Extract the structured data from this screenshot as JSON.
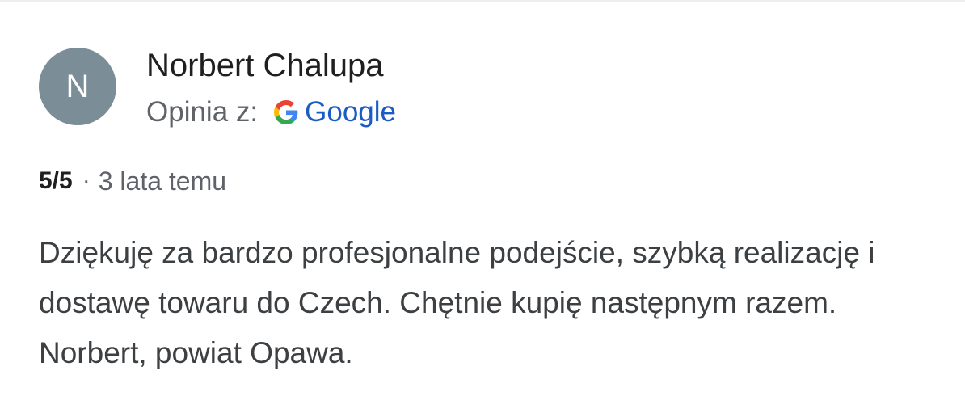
{
  "review": {
    "avatar_letter": "N",
    "author_name": "Norbert Chalupa",
    "source_label": "Opinia z:",
    "source_icon": "google-g-icon",
    "source_name": "Google",
    "rating": "5/5",
    "separator": "·",
    "time_ago": "3 lata temu",
    "text": "Dziękuję za bardzo profesjonalne podejście, szybką realizację i dostawę towaru do Czech. Chętnie kupię następnym razem. Norbert, powiat Opawa."
  },
  "colors": {
    "avatar_bg": "#7b8d97",
    "link": "#1a5bc4",
    "name": "#1f1f1f",
    "muted": "#5f6368",
    "body_text": "#3c4043"
  }
}
